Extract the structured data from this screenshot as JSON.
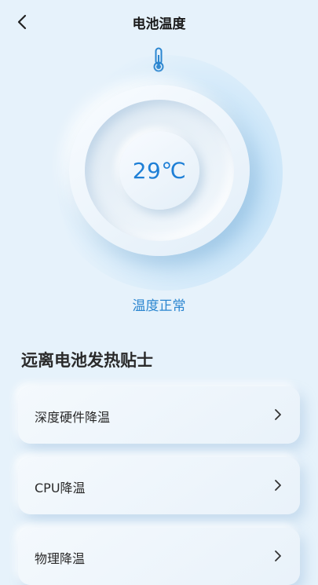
{
  "header": {
    "title": "电池温度"
  },
  "gauge": {
    "temperature": "29℃",
    "status": "温度正常"
  },
  "tips": {
    "title": "远离电池发热贴士",
    "items": [
      {
        "label": "深度硬件降温"
      },
      {
        "label": "CPU降温"
      },
      {
        "label": "物理降温"
      }
    ]
  },
  "colors": {
    "accent": "#1e7fd6",
    "background": "#e6f2fb"
  },
  "icons": {
    "back": "chevron-left-icon",
    "thermometer": "thermometer-icon",
    "item_arrow": "chevron-right-icon"
  }
}
